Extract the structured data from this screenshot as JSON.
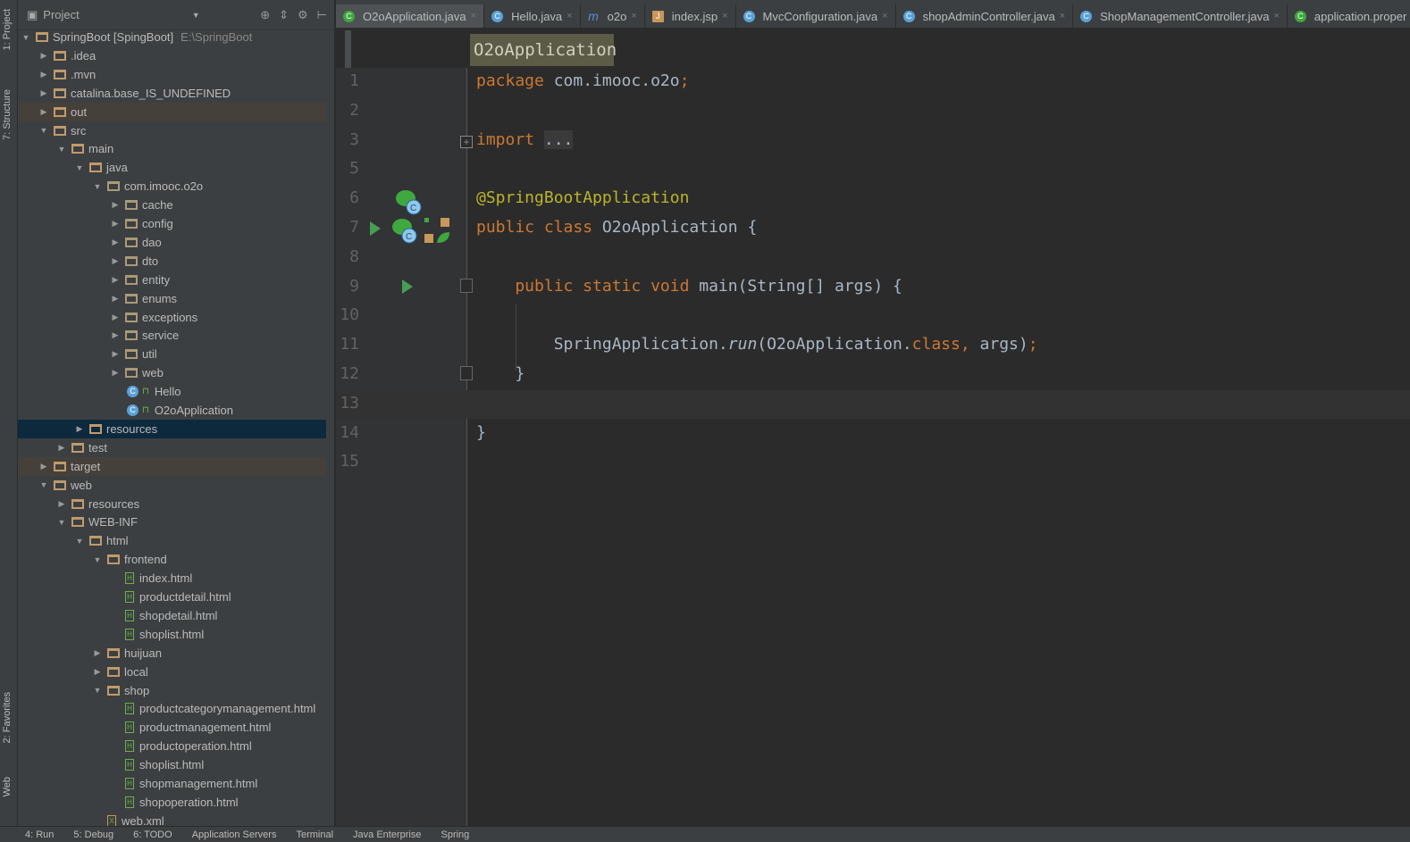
{
  "left_strip": [
    "1: Project",
    "7: Structure",
    "2: Favorites",
    "Web"
  ],
  "project_panel": {
    "title": "Project",
    "root_path": "E:\\SpringBoot",
    "tree": [
      {
        "label": "SpringBoot [SpingBoot]",
        "depth": 0,
        "arrow": "open",
        "kind": "module"
      },
      {
        "label": ".idea",
        "depth": 1,
        "arrow": "closed",
        "kind": "folder"
      },
      {
        "label": ".mvn",
        "depth": 1,
        "arrow": "closed",
        "kind": "folder"
      },
      {
        "label": "catalina.base_IS_UNDEFINED",
        "depth": 1,
        "arrow": "closed",
        "kind": "folder"
      },
      {
        "label": "out",
        "depth": 1,
        "arrow": "closed",
        "kind": "folder",
        "excluded": true
      },
      {
        "label": "src",
        "depth": 1,
        "arrow": "open",
        "kind": "folder"
      },
      {
        "label": "main",
        "depth": 2,
        "arrow": "open",
        "kind": "folder"
      },
      {
        "label": "java",
        "depth": 3,
        "arrow": "open",
        "kind": "folder"
      },
      {
        "label": "com.imooc.o2o",
        "depth": 4,
        "arrow": "open",
        "kind": "package"
      },
      {
        "label": "cache",
        "depth": 5,
        "arrow": "closed",
        "kind": "package"
      },
      {
        "label": "config",
        "depth": 5,
        "arrow": "closed",
        "kind": "package"
      },
      {
        "label": "dao",
        "depth": 5,
        "arrow": "closed",
        "kind": "package"
      },
      {
        "label": "dto",
        "depth": 5,
        "arrow": "closed",
        "kind": "package"
      },
      {
        "label": "entity",
        "depth": 5,
        "arrow": "closed",
        "kind": "package"
      },
      {
        "label": "enums",
        "depth": 5,
        "arrow": "closed",
        "kind": "package"
      },
      {
        "label": "exceptions",
        "depth": 5,
        "arrow": "closed",
        "kind": "package"
      },
      {
        "label": "service",
        "depth": 5,
        "arrow": "closed",
        "kind": "package"
      },
      {
        "label": "util",
        "depth": 5,
        "arrow": "closed",
        "kind": "package"
      },
      {
        "label": "web",
        "depth": 5,
        "arrow": "closed",
        "kind": "package"
      },
      {
        "label": "Hello",
        "depth": 5,
        "arrow": "none",
        "kind": "class"
      },
      {
        "label": "O2oApplication",
        "depth": 5,
        "arrow": "none",
        "kind": "class"
      },
      {
        "label": "resources",
        "depth": 3,
        "arrow": "closed",
        "kind": "folder",
        "selected": true
      },
      {
        "label": "test",
        "depth": 2,
        "arrow": "closed",
        "kind": "folder"
      },
      {
        "label": "target",
        "depth": 1,
        "arrow": "closed",
        "kind": "folder",
        "excluded": true
      },
      {
        "label": "web",
        "depth": 1,
        "arrow": "open",
        "kind": "folder"
      },
      {
        "label": "resources",
        "depth": 2,
        "arrow": "closed",
        "kind": "folder"
      },
      {
        "label": "WEB-INF",
        "depth": 2,
        "arrow": "open",
        "kind": "folder"
      },
      {
        "label": "html",
        "depth": 3,
        "arrow": "open",
        "kind": "folder"
      },
      {
        "label": "frontend",
        "depth": 4,
        "arrow": "open",
        "kind": "folder"
      },
      {
        "label": "index.html",
        "depth": 5,
        "arrow": "none",
        "kind": "html"
      },
      {
        "label": "productdetail.html",
        "depth": 5,
        "arrow": "none",
        "kind": "html"
      },
      {
        "label": "shopdetail.html",
        "depth": 5,
        "arrow": "none",
        "kind": "html"
      },
      {
        "label": "shoplist.html",
        "depth": 5,
        "arrow": "none",
        "kind": "html"
      },
      {
        "label": "huijuan",
        "depth": 4,
        "arrow": "closed",
        "kind": "folder"
      },
      {
        "label": "local",
        "depth": 4,
        "arrow": "closed",
        "kind": "folder"
      },
      {
        "label": "shop",
        "depth": 4,
        "arrow": "open",
        "kind": "folder"
      },
      {
        "label": "productcategorymanagement.html",
        "depth": 5,
        "arrow": "none",
        "kind": "html"
      },
      {
        "label": "productmanagement.html",
        "depth": 5,
        "arrow": "none",
        "kind": "html"
      },
      {
        "label": "productoperation.html",
        "depth": 5,
        "arrow": "none",
        "kind": "html"
      },
      {
        "label": "shoplist.html",
        "depth": 5,
        "arrow": "none",
        "kind": "html"
      },
      {
        "label": "shopmanagement.html",
        "depth": 5,
        "arrow": "none",
        "kind": "html"
      },
      {
        "label": "shopoperation.html",
        "depth": 5,
        "arrow": "none",
        "kind": "html"
      },
      {
        "label": "web.xml",
        "depth": 4,
        "arrow": "none",
        "kind": "xml"
      }
    ]
  },
  "tabs": [
    {
      "label": "O2oApplication.java",
      "icon": "spring-class-icon",
      "active": true
    },
    {
      "label": "Hello.java",
      "icon": "class-icon"
    },
    {
      "label": "o2o",
      "icon": "maven-icon"
    },
    {
      "label": "index.jsp",
      "icon": "jsp-icon"
    },
    {
      "label": "MvcConfiguration.java",
      "icon": "class-icon"
    },
    {
      "label": "shopAdminController.java",
      "icon": "class-icon"
    },
    {
      "label": "ShopManagementController.java",
      "icon": "class-icon"
    },
    {
      "label": "application.proper",
      "icon": "spring-properties-icon"
    }
  ],
  "breadcrumb": "O2oApplication",
  "editor": {
    "lines": [
      {
        "n": "1",
        "tokens": [
          [
            "package ",
            "kw"
          ],
          [
            "com.imooc.o2o",
            ""
          ],
          [
            ";",
            "kw"
          ]
        ]
      },
      {
        "n": "2",
        "tokens": []
      },
      {
        "n": "3",
        "tokens": [
          [
            "import ",
            "kw"
          ],
          [
            "...",
            "fd"
          ]
        ]
      },
      {
        "n": "5",
        "tokens": []
      },
      {
        "n": "6",
        "tokens": [
          [
            "@SpringBootApplication",
            "an"
          ]
        ]
      },
      {
        "n": "7",
        "tokens": [
          [
            "public class ",
            "kw"
          ],
          [
            "O2oApplication {",
            ""
          ]
        ]
      },
      {
        "n": "8",
        "tokens": []
      },
      {
        "n": "9",
        "tokens": [
          [
            "    public static void ",
            "kw"
          ],
          [
            "main(String[] args) {",
            ""
          ]
        ]
      },
      {
        "n": "10",
        "tokens": []
      },
      {
        "n": "11",
        "tokens": [
          [
            "        SpringApplication.",
            ""
          ],
          [
            "run",
            "it"
          ],
          [
            "(O2oApplication.",
            ""
          ],
          [
            "class, ",
            "kw"
          ],
          [
            "args)",
            ""
          ],
          [
            ";",
            "kw"
          ]
        ]
      },
      {
        "n": "12",
        "tokens": [
          [
            "    }",
            ""
          ]
        ]
      },
      {
        "n": "13",
        "tokens": []
      },
      {
        "n": "14",
        "tokens": [
          [
            "}",
            ""
          ]
        ]
      },
      {
        "n": "15",
        "tokens": []
      }
    ]
  },
  "bottom_tools": [
    "4: Run",
    "5: Debug",
    "6: TODO",
    "Application Servers",
    "Terminal",
    "Java Enterprise",
    "Spring"
  ],
  "colors": {
    "keyword": "#cc7832",
    "annotation": "#bbb529",
    "text": "#a9b7c6",
    "selection": "#0d293e"
  }
}
